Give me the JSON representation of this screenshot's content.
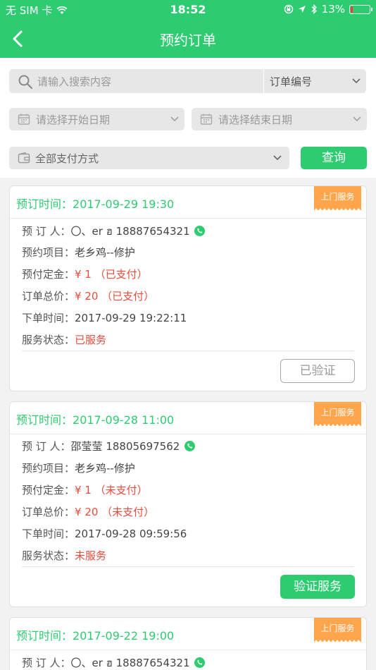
{
  "status_bar": {
    "carrier": "无 SIM 卡",
    "time": "18:52",
    "battery_percent": "13%",
    "battery_level": 0.13
  },
  "nav": {
    "title": "预约订单"
  },
  "filters": {
    "search_placeholder": "请输入搜索内容",
    "order_type": "订单编号",
    "start_date_placeholder": "请选择开始日期",
    "end_date_placeholder": "请选择结束日期",
    "payment_method": "全部支付方式",
    "query_label": "查询"
  },
  "labels": {
    "book_time": "预订时间：",
    "booker": "预 订 人：",
    "item": "预约项目：",
    "deposit": "预付定金：",
    "total": "订单总价：",
    "order_time": "下单时间：",
    "service_status": "服务状态："
  },
  "orders": [
    {
      "book_time": "2017-09-29 19:30",
      "tag": "上门服务",
      "booker": "〇、er ฮ 18887654321",
      "item": "老乡鸡--修护",
      "deposit": "¥ 1 （已支付）",
      "total": "¥ 20 （已支付）",
      "order_time": "2017-09-29 19:22:11",
      "status": "已服务",
      "action": "已验证"
    },
    {
      "book_time": "2017-09-28 11:00",
      "tag": "上门服务",
      "booker": "邵莹莹 18805697562",
      "item": "老乡鸡--修护",
      "deposit": "¥ 1 （未支付）",
      "total": "¥ 20 （未支付）",
      "order_time": "2017-09-28 09:59:56",
      "status": "未服务",
      "action": "验证服务"
    },
    {
      "book_time": "2017-09-22 19:00",
      "tag": "上门服务",
      "booker": "〇、er ฮ 18887654321"
    }
  ],
  "colors": {
    "primary": "#2ecc71",
    "tag": "#ffa64d",
    "alert": "#e74c3c"
  }
}
